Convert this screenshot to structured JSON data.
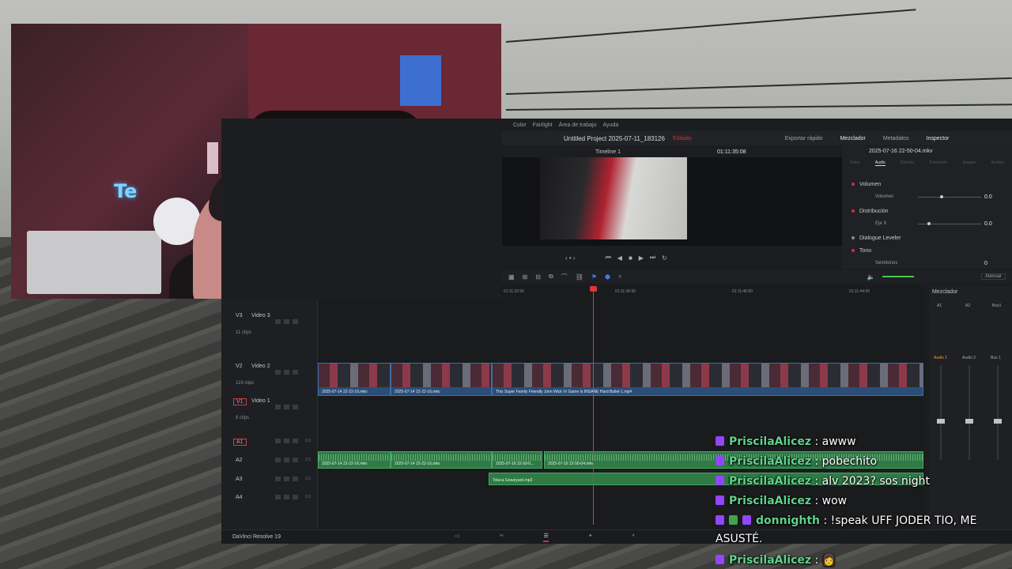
{
  "resolve": {
    "menu": [
      "Color",
      "Fairlight",
      "Área de trabajo",
      "Ayuda"
    ],
    "project_title": "Untitled Project 2025-07-11_183126",
    "project_state": "Editado",
    "header_buttons": [
      "Exportar rápido",
      "Mezclador",
      "Metadatos",
      "Inspector"
    ],
    "timeline_name": "Timeline 1",
    "timecode": "01:11:35:08",
    "inspector": {
      "clip_name": "2025-07-16 22-50-04.mkv",
      "tabs": [
        "Video",
        "Audio",
        "Efectos",
        "Transición",
        "Imagen",
        "Archivo"
      ],
      "active_tab": "Audio",
      "rows": [
        {
          "label": "Volumen",
          "sub": "Volumen",
          "value": "0.0"
        },
        {
          "label": "Distribución",
          "sub": "Eje X",
          "value": "0.0"
        },
        {
          "label": "Dialogue Leveler"
        },
        {
          "label": "Tono",
          "sub": "Semitonos",
          "value": "0"
        }
      ]
    },
    "toolbar": {
      "attenuate": "Atenuar"
    },
    "ruler": [
      "01:11:32:00",
      "01:11:36:00",
      "01:11:40:00",
      "01:11:44:00"
    ],
    "tracks": {
      "v3": {
        "id": "V3",
        "name": "Video 3",
        "count": "11 clips"
      },
      "v2": {
        "id": "V2",
        "name": "Video 2",
        "count": "119 clips"
      },
      "v1": {
        "id": "V1",
        "name": "Video 1",
        "count": "8 clips"
      },
      "a1": {
        "id": "A1",
        "level": "2.0"
      },
      "a2": {
        "id": "A2",
        "level": "2.0"
      },
      "a3": {
        "id": "A3",
        "level": "2.0"
      },
      "a4": {
        "id": "A4",
        "level": "2.0"
      }
    },
    "clips": {
      "v2_1": "2025-07-14 22-22-16.mkv",
      "v2_2": "2025-07-14 22-22-16.mkv",
      "v2_3": "This Super Family Friendly John Wick Vr Game Is INSANE  Hard Bullet-1.mp4",
      "a2_1": "2025-07-14 22-22-16.mkv",
      "a2_2": "2025-07-14 22-22-16.mkv",
      "a2_3": "2025-07-16 22-50-0...",
      "a2_4": "2025-07-16 22-50-04.mkv",
      "a3_1": "Toluca Graveyard.mp3"
    },
    "mixer": {
      "title": "Mezclador",
      "channels": [
        "A1",
        "A2",
        "Bus1"
      ],
      "strips": [
        "Audio 1",
        "Audio 2",
        "Bus 1"
      ]
    },
    "brand": "DaVinci Resolve 19"
  },
  "webcam": {
    "neon_text": "Te"
  },
  "chat": [
    {
      "user": "PriscilaAlicez",
      "text": " : awww"
    },
    {
      "user": "PriscilaAlicez",
      "text": " : pobechito"
    },
    {
      "user": "PriscilaAlicez",
      "text": " : alv 2023? sos night"
    },
    {
      "user": "PriscilaAlicez",
      "text": " : wow"
    },
    {
      "user": "donnighth",
      "text": " : !speak UFF JODER TIO, ME ASUSTÉ."
    },
    {
      "user": "PriscilaAlicez",
      "text": " : 👩"
    }
  ],
  "colors": {
    "accent_red": "#d0313a",
    "video_clip": "#2a4e78",
    "audio_clip": "#2f7a45",
    "chat_user": "#5fd28c",
    "twitch_badge": "#9146ff"
  }
}
